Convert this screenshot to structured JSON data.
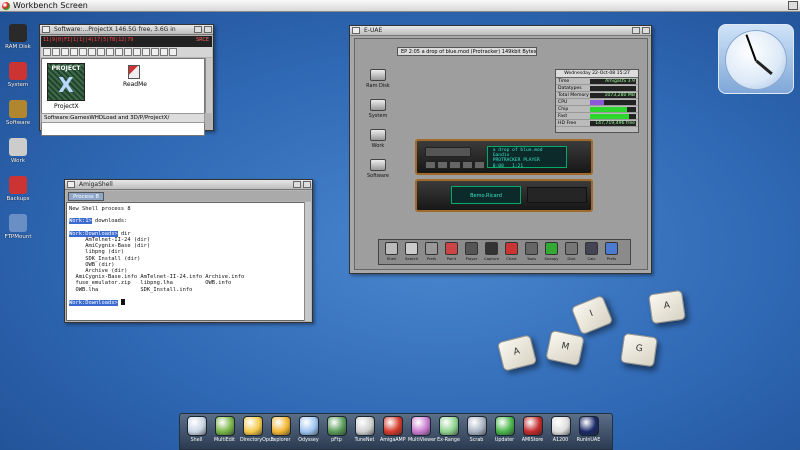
{
  "screen": {
    "title": "Workbench Screen"
  },
  "desktop_icons": [
    {
      "label": "RAM Disk",
      "icon": "ram-disk-icon",
      "color": "#2a2a2a"
    },
    {
      "label": "System",
      "icon": "boing-ball-icon",
      "color": "#c33"
    },
    {
      "label": "Software",
      "icon": "drawer-icon",
      "color": "#b0862f"
    },
    {
      "label": "Work",
      "icon": "drive-icon",
      "color": "#ccc"
    },
    {
      "label": "Backups",
      "icon": "boing-ball-icon",
      "color": "#c33"
    },
    {
      "label": "FTPMount",
      "icon": "network-drive-icon",
      "color": "#6a8fc4"
    }
  ],
  "software_window": {
    "title": "Software:...ProjectX  146.5G free, 3.6G in",
    "status_line": "11|9|0|FI|1|1||4|17|5|TB|12|79",
    "source_label": "SRCE",
    "project_label": "ProjectX",
    "project_art_top": "PROJECT",
    "project_art_big": "X",
    "readme_label": "ReadMe",
    "path": "Software:GamesWHDLoad and 3D/P/ProjectX/"
  },
  "shell_window": {
    "title": "AmigaShell",
    "tab": "Process 8",
    "lines": [
      "New Shell process 8",
      "",
      "Work:1> downloads:",
      "",
      "Work:Downloads> dir",
      "     AmTelnet-II-24 (dir)",
      "     AmiCygnix-Base (dir)",
      "     libpng (dir)",
      "     SDK_Install (dir)",
      "     OWB (dir)",
      "     Archive (dir)",
      "  AmiCygnix-Base.info AmTelnet-II-24.info Archive.info",
      "  fuse_emulator.zip   libpng.lha          OWB.info",
      "  OWB.lha             SDK_Install.info",
      "",
      "Work:Downloads>"
    ]
  },
  "uae_window": {
    "title": "E-UAE",
    "track": "EP 2:05 a drop of blue.mod (Protracker) 149kbit Bytes",
    "icons": [
      {
        "label": "Ram Disk"
      },
      {
        "label": "System"
      },
      {
        "label": "Work"
      },
      {
        "label": "Software"
      }
    ],
    "sysmon": {
      "date": "Wednesday 22-Oct-08  15:27",
      "rows": [
        {
          "k": "Time",
          "v": "AmigaOS 3.9"
        },
        {
          "k": "Datatypes",
          "v": ""
        },
        {
          "k": "Total Memory",
          "v": "1073,280 MB"
        }
      ],
      "bars": [
        {
          "k": "CPU",
          "fill": 0.3,
          "color": "#8c58d8"
        },
        {
          "k": "Chip",
          "fill": 0.8,
          "color": "#2cd62c"
        },
        {
          "k": "Fast",
          "fill": 0.85,
          "color": "#2cd62c"
        }
      ],
      "hd_label": "HD Free",
      "hd_value": "147,719,496 free"
    },
    "player_lcd": " a drop of blue.mod\n Gandix\n PROTRACKER PLAYER\n 0:00   1:21",
    "spectrum_label": "Bemo.Ricard",
    "dock": [
      {
        "label": "Shell",
        "color": "#bbb"
      },
      {
        "label": "Search",
        "color": "#ccc"
      },
      {
        "label": "Prefs",
        "color": "#999"
      },
      {
        "label": "Paint",
        "color": "#c44"
      },
      {
        "label": "Player",
        "color": "#555"
      },
      {
        "label": "Capture",
        "color": "#333"
      },
      {
        "label": "Chart",
        "color": "#c33"
      },
      {
        "label": "Tools",
        "color": "#666"
      },
      {
        "label": "Snoopy",
        "color": "#3a3"
      },
      {
        "label": "Disk",
        "color": "#777"
      },
      {
        "label": "Calc",
        "color": "#445"
      },
      {
        "label": "Prefs",
        "color": "#4a7bd1"
      }
    ]
  },
  "keycaps": [
    "A",
    "M",
    "I",
    "G",
    "A"
  ],
  "dock": [
    {
      "label": "Shell",
      "color": "#c9d4e4"
    },
    {
      "label": "MultiEdit",
      "color": "#7ab54a"
    },
    {
      "label": "DirectoryOpus",
      "color": "#f4c94a"
    },
    {
      "label": "Explorer",
      "color": "#f2b634"
    },
    {
      "label": "Odyssey",
      "color": "#9ec4f2"
    },
    {
      "label": "pFtp",
      "color": "#5a9a5a"
    },
    {
      "label": "TuneNet",
      "color": "#cfcfcf"
    },
    {
      "label": "AmigaAMP",
      "color": "#d43a2a"
    },
    {
      "label": "MultiViewer",
      "color": "#c97cd1"
    },
    {
      "label": "Ex-Range",
      "color": "#8fd28f"
    },
    {
      "label": "Scrab",
      "color": "#aab4c4"
    },
    {
      "label": "Updater",
      "color": "#49b64a"
    },
    {
      "label": "AMIStore",
      "color": "#c32a2a"
    },
    {
      "label": "A1200",
      "color": "#ddd"
    },
    {
      "label": "RunInUAE",
      "color": "#1a2a6a"
    }
  ],
  "colors": {
    "accent": "#3b6ad0",
    "desktop": "#2f68b4"
  }
}
